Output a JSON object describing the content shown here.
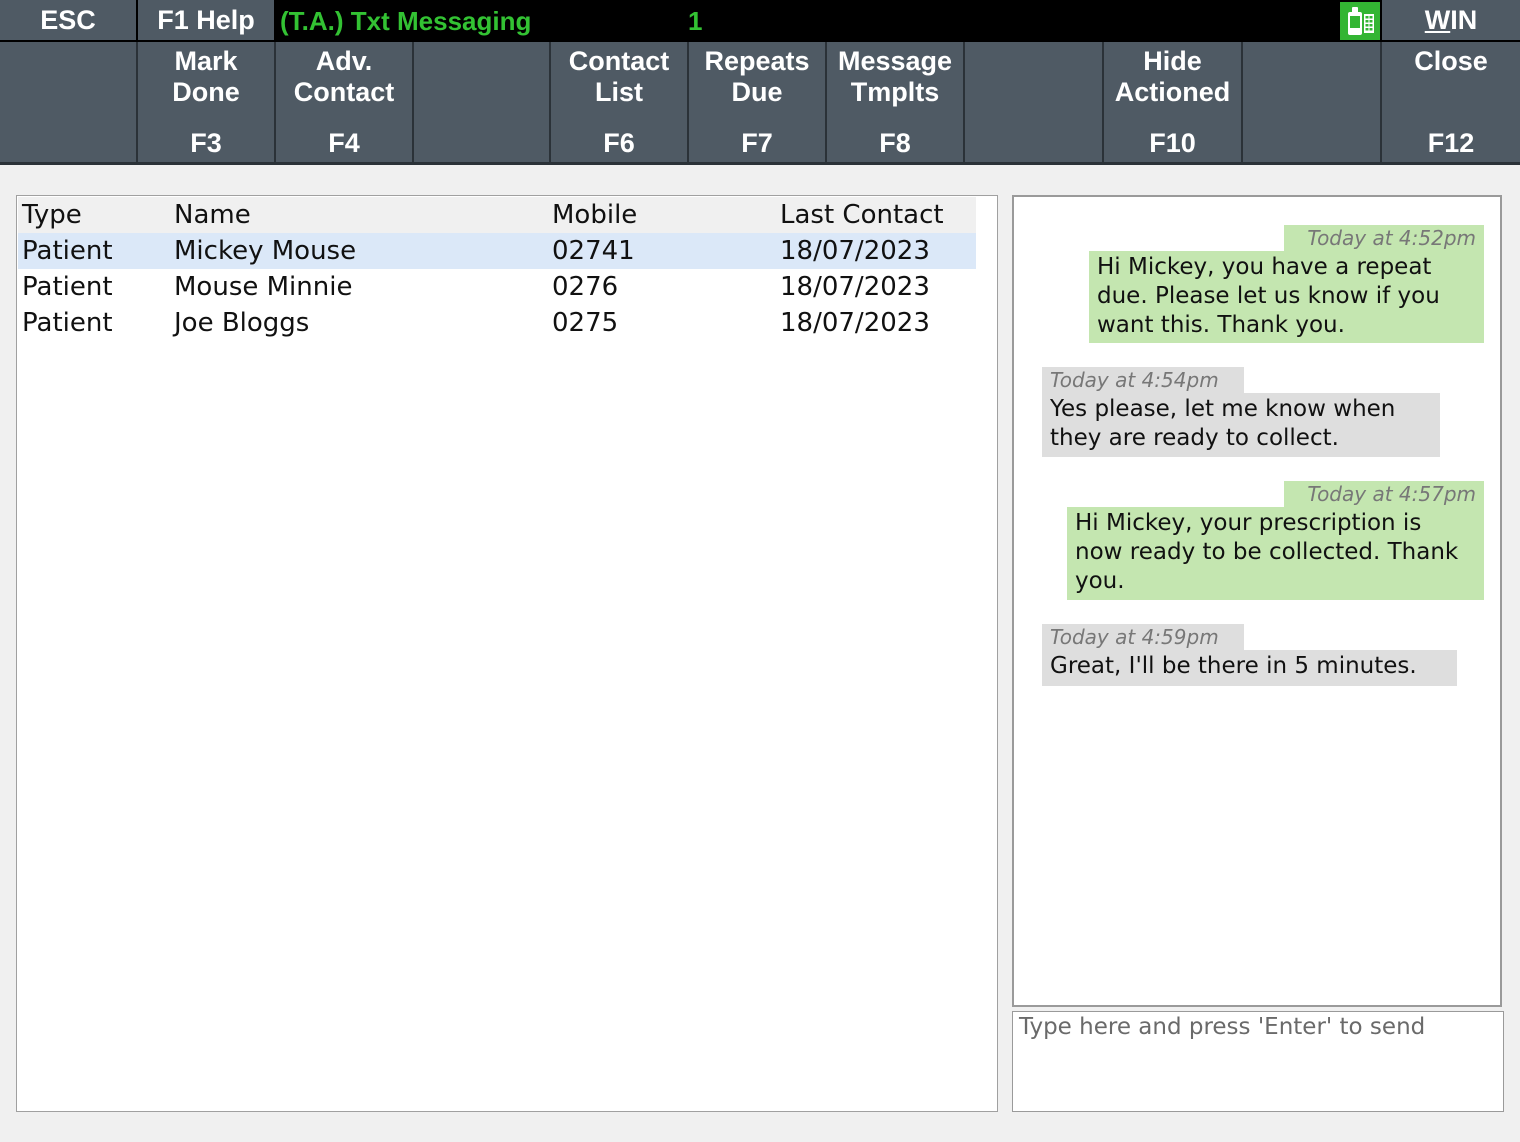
{
  "topbar": {
    "esc_label": "ESC",
    "help_label": "F1 Help",
    "title": "(T.A.) Txt Messaging",
    "count": "1",
    "app_icon": "sms-phone-icon",
    "win_w": "W",
    "win_rest": "IN"
  },
  "fkeys": [
    {
      "label": "",
      "key": ""
    },
    {
      "label": "Mark\nDone",
      "key": "F3"
    },
    {
      "label": "Adv.\nContact",
      "key": "F4"
    },
    {
      "label": "",
      "key": ""
    },
    {
      "label": "Contact\nList",
      "key": "F6"
    },
    {
      "label": "Repeats\nDue",
      "key": "F7"
    },
    {
      "label": "Message\nTmplts",
      "key": "F8"
    },
    {
      "label": "",
      "key": ""
    },
    {
      "label": "Hide\nActioned",
      "key": "F10"
    },
    {
      "label": "",
      "key": ""
    },
    {
      "label": "Close",
      "key": "F12"
    }
  ],
  "contacts": {
    "columns": [
      "Type",
      "Name",
      "Mobile",
      "Last Contact"
    ],
    "rows": [
      {
        "type": "Patient",
        "name": "Mickey Mouse",
        "mobile": "02741",
        "last_contact": "18/07/2023",
        "selected": true
      },
      {
        "type": "Patient",
        "name": "Mouse Minnie",
        "mobile": "0276",
        "last_contact": "18/07/2023",
        "selected": false
      },
      {
        "type": "Patient",
        "name": "Joe Bloggs",
        "mobile": "0275",
        "last_contact": "18/07/2023",
        "selected": false
      }
    ]
  },
  "messages": [
    {
      "direction": "outgoing",
      "time": "Today at 4:52pm",
      "lines": [
        "Hi Mickey, you have a repeat",
        "due. Please let us know if you",
        "want this. Thank you."
      ]
    },
    {
      "direction": "incoming",
      "time": "Today at 4:54pm",
      "lines": [
        "Yes please, let me know when",
        "they are ready to collect."
      ]
    },
    {
      "direction": "outgoing",
      "time": "Today at 4:57pm",
      "lines": [
        "Hi Mickey, your prescription is",
        "now ready to be collected. Thank",
        "you."
      ]
    },
    {
      "direction": "incoming",
      "time": "Today at 4:59pm",
      "lines": [
        "Great, I'll be there in 5 minutes."
      ]
    }
  ],
  "compose": {
    "placeholder": "Type here and press 'Enter' to send",
    "value": ""
  },
  "colors": {
    "toolbar": "#4f5a64",
    "title_green": "#33c233",
    "outgoing_bubble": "#c4e6b0",
    "incoming_bubble": "#dedede",
    "selected_row": "#dbe8f8"
  }
}
